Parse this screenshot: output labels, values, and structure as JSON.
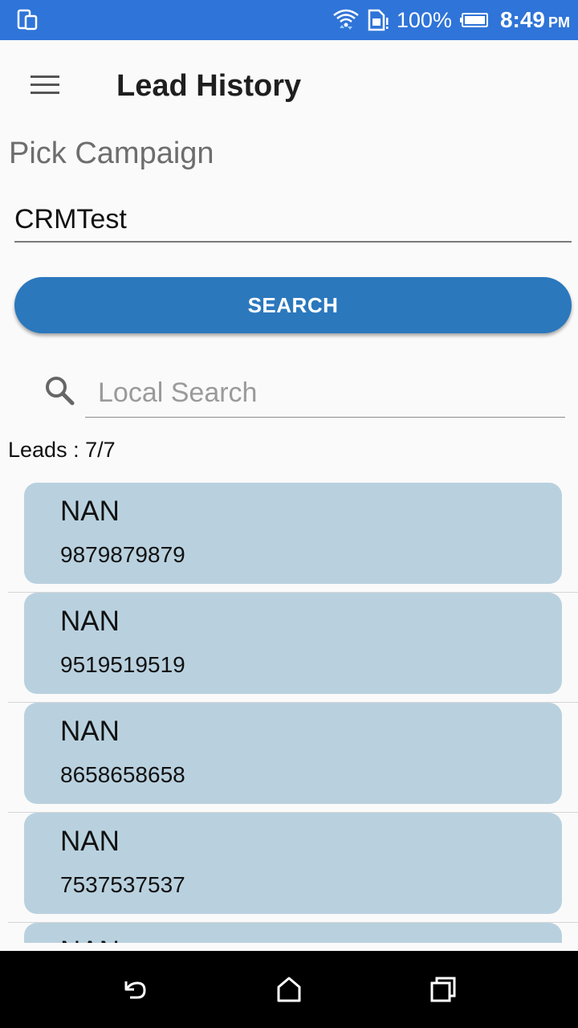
{
  "status_bar": {
    "battery_percent": "100%",
    "time": "8:49",
    "ampm": "PM",
    "icons": [
      "phone-rotate-icon",
      "wifi-icon",
      "sim-card-icon",
      "battery-icon"
    ]
  },
  "app_bar": {
    "title": "Lead History",
    "menu_icon": "hamburger-menu-icon"
  },
  "form": {
    "pick_campaign_label": "Pick Campaign",
    "campaign_value": "CRMTest",
    "search_button_label": "SEARCH",
    "local_search_placeholder": "Local Search",
    "local_search_value": ""
  },
  "leads": {
    "count_text": "Leads : 7/7",
    "items": [
      {
        "name": "NAN",
        "phone": "9879879879"
      },
      {
        "name": "NAN",
        "phone": "9519519519"
      },
      {
        "name": "NAN",
        "phone": "8658658658"
      },
      {
        "name": "NAN",
        "phone": "7537537537"
      },
      {
        "name": "NAN",
        "phone": ""
      }
    ]
  },
  "colors": {
    "status_bar": "#2f74d8",
    "button": "#2b78bd",
    "card": "#b9d1df"
  },
  "nav_bar": {
    "icons": [
      "back-icon",
      "home-icon",
      "recents-icon"
    ]
  }
}
